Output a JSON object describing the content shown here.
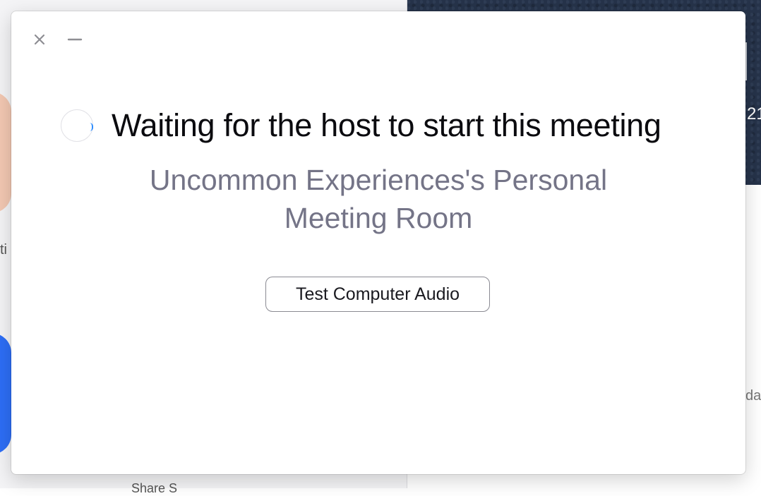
{
  "dialog": {
    "status_title": "Waiting for the host to start this meeting",
    "meeting_name_line1": "Uncommon Experiences's Personal",
    "meeting_name_line2": "Meeting Room",
    "test_audio_label": "Test Computer Audio",
    "icons": {
      "close": "close-icon",
      "minimize": "minimize-icon",
      "loading": "loading-spinner-icon"
    }
  },
  "background": {
    "clock_fragment": "21",
    "left_fragment": "ti",
    "right_fragment": "da",
    "bottom_fragment": "Share S"
  },
  "colors": {
    "accent": "#2d8cff",
    "subtitle": "#747487",
    "clock_panel": "#26334a",
    "peach_tile": "#f3c8b2",
    "blue_tile": "#2d6ef6"
  }
}
